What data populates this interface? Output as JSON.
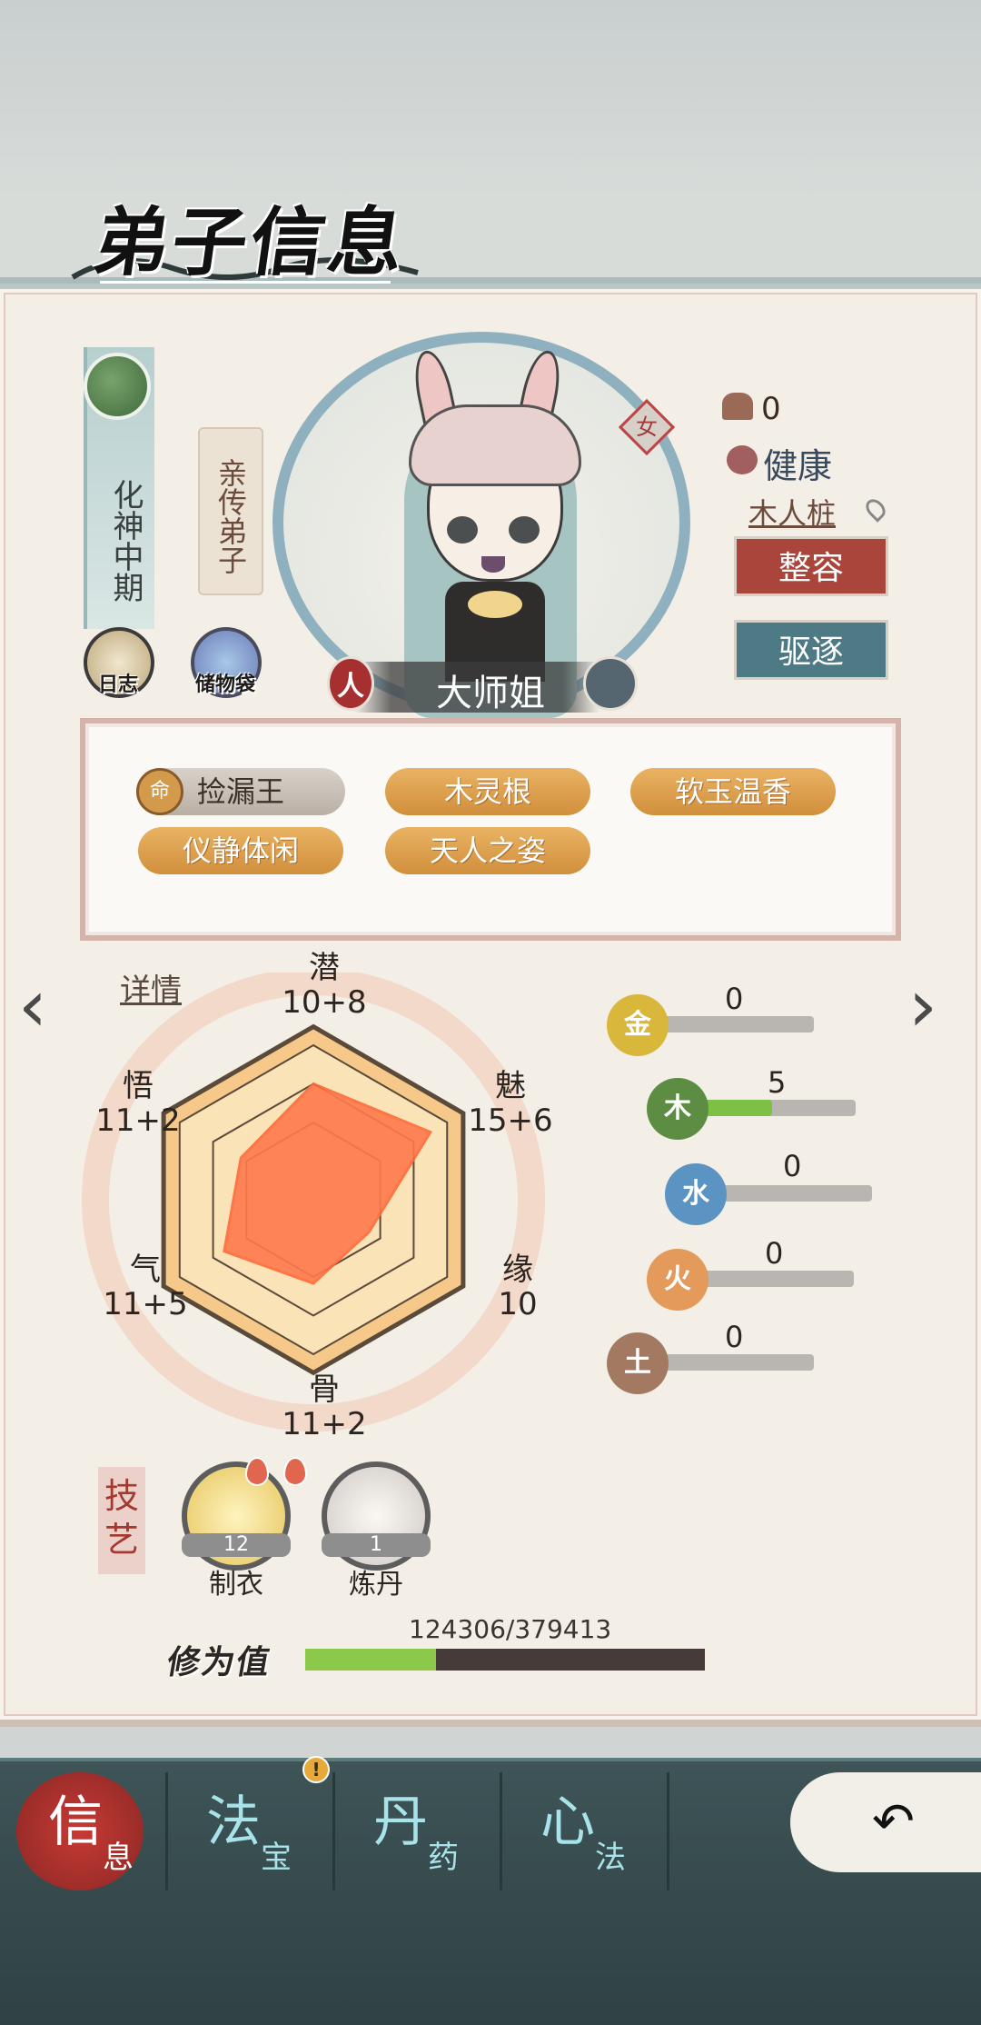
{
  "header": {
    "title": "弟子信息"
  },
  "disciple": {
    "realm": "化神中期",
    "role": "亲传弟子",
    "name": "大师姐",
    "gender": "女",
    "name_badge_left": "人",
    "count": "0",
    "health": "健康",
    "location": "木人桩"
  },
  "quick_buttons": {
    "log": "日志",
    "bag": "储物袋"
  },
  "actions": {
    "makeover": "整容",
    "expel": "驱逐"
  },
  "traits": {
    "badge": "命",
    "items": [
      "捡漏王",
      "木灵根",
      "软玉温香",
      "仪静体闲",
      "天人之姿"
    ]
  },
  "details_link": "详情",
  "chart_data": {
    "type": "radar",
    "axes": [
      "潜",
      "魅",
      "缘",
      "骨",
      "气",
      "悟"
    ],
    "labels": [
      "10+8",
      "15+6",
      "10",
      "11+2",
      "11+5",
      "11+2"
    ],
    "base": [
      10,
      15,
      10,
      11,
      11,
      11
    ],
    "bonus": [
      8,
      6,
      0,
      2,
      5,
      2
    ],
    "values": [
      18,
      21,
      10,
      13,
      16,
      13
    ],
    "max": 24
  },
  "elements": [
    {
      "name": "金",
      "value": "0",
      "fraction": 0,
      "color": "#d8b73a"
    },
    {
      "name": "木",
      "value": "5",
      "fraction": 0.45,
      "color": "#5d8d43"
    },
    {
      "name": "水",
      "value": "0",
      "fraction": 0,
      "color": "#5b94c2"
    },
    {
      "name": "火",
      "value": "0",
      "fraction": 0,
      "color": "#e39a5a"
    },
    {
      "name": "土",
      "value": "0",
      "fraction": 0,
      "color": "#a37a61"
    }
  ],
  "skills": {
    "label": "技艺",
    "items": [
      {
        "name": "制衣",
        "level": "12"
      },
      {
        "name": "炼丹",
        "level": "1"
      }
    ]
  },
  "cultivation": {
    "label": "修为值",
    "current": 124306,
    "max": 379413,
    "text": "124306/379413"
  },
  "nav": {
    "info": {
      "big": "信",
      "small": "息"
    },
    "treasure": {
      "big": "法",
      "small": "宝"
    },
    "pill": {
      "big": "丹",
      "small": "药"
    },
    "method": {
      "big": "心",
      "small": "法"
    },
    "alert": "!"
  }
}
